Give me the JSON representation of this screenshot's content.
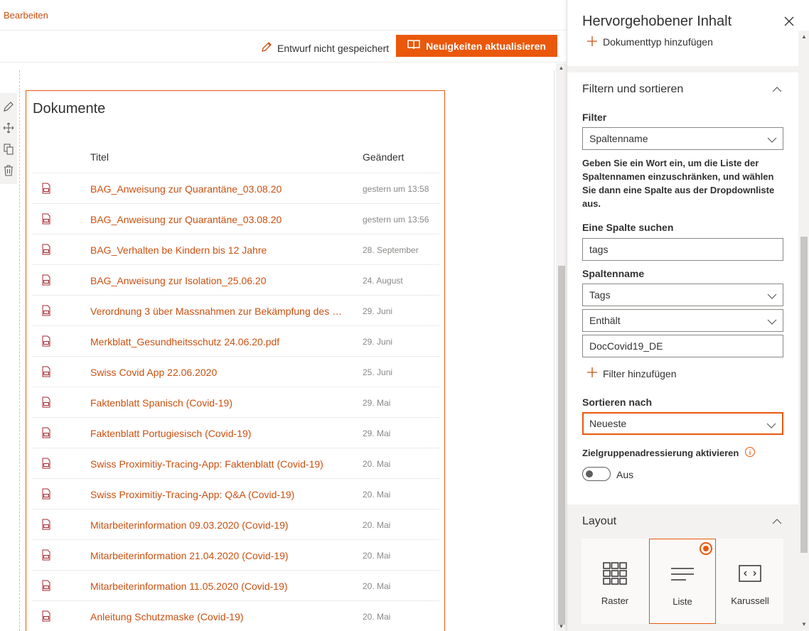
{
  "topbar": {
    "edit_label": "Bearbeiten"
  },
  "commandbar": {
    "draft_status": "Entwurf nicht gespeichert",
    "update_news_button": "Neuigkeiten aktualisieren"
  },
  "webpart": {
    "title": "Dokumente",
    "columns": {
      "title": "Titel",
      "modified": "Geändert"
    },
    "rows": [
      {
        "name": "BAG_Anweisung zur Quarantäne_03.08.20",
        "modified": "gestern um 13:58"
      },
      {
        "name": "BAG_Anweisung zur Quarantäne_03.08.20",
        "modified": "gestern um 13:56"
      },
      {
        "name": "BAG_Verhalten be Kindern bis 12 Jahre",
        "modified": "28. September"
      },
      {
        "name": "BAG_Anweisung zur Isolation_25.06.20",
        "modified": "24. August"
      },
      {
        "name": "Verordnung 3 über Massnahmen zur Bekämpfung des C...",
        "modified": "29. Juni"
      },
      {
        "name": "Merkblatt_Gesundheitsschutz 24.06.20.pdf",
        "modified": "29. Juni"
      },
      {
        "name": "Swiss Covid App 22.06.2020",
        "modified": "25. Juni"
      },
      {
        "name": "Faktenblatt Spanisch (Covid-19)",
        "modified": "29. Mai"
      },
      {
        "name": "Faktenblatt Portugiesisch (Covid-19)",
        "modified": "29. Mai"
      },
      {
        "name": "Swiss Proximitiy-Tracing-App: Faktenblatt (Covid-19)",
        "modified": "20. Mai"
      },
      {
        "name": "Swiss Proximitiy-Tracing-App: Q&A (Covid-19)",
        "modified": "20. Mai"
      },
      {
        "name": "Mitarbeiterinformation 09.03.2020 (Covid-19)",
        "modified": "20. Mai"
      },
      {
        "name": "Mitarbeiterinformation 21.04.2020 (Covid-19)",
        "modified": "20. Mai"
      },
      {
        "name": "Mitarbeiterinformation 11.05.2020 (Covid-19)",
        "modified": "20. Mai"
      },
      {
        "name": "Anleitung Schutzmaske (Covid-19)",
        "modified": "20. Mai"
      }
    ]
  },
  "panel": {
    "title": "Hervorgehobener Inhalt",
    "add_doctype": "Dokumenttyp hinzufügen",
    "filter_section": {
      "heading": "Filtern und sortieren",
      "filter_label": "Filter",
      "filter_value": "Spaltenname",
      "help": "Geben Sie ein Wort ein, um die Liste der Spaltennamen einzuschränken, und wählen Sie dann eine Spalte aus der Dropdownliste aus.",
      "search_label": "Eine Spalte suchen",
      "search_value": "tags",
      "column_label": "Spaltenname",
      "column_value": "Tags",
      "operator_value": "Enthält",
      "filter_text_value": "DocCovid19_DE",
      "add_filter": "Filter hinzufügen",
      "sort_label": "Sortieren nach",
      "sort_value": "Neueste",
      "audience_label": "Zielgruppenadressierung aktivieren",
      "toggle_state": "Aus"
    },
    "layout_section": {
      "heading": "Layout",
      "options": [
        {
          "label": "Raster",
          "selected": false
        },
        {
          "label": "Liste",
          "selected": true
        },
        {
          "label": "Karussell",
          "selected": false
        }
      ]
    }
  },
  "colors": {
    "accent": "#ea580c",
    "link": "#ca5010"
  }
}
